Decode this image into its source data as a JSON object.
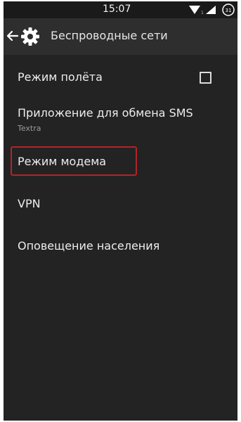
{
  "status_bar": {
    "time": "15:07",
    "icons": [
      "wifi-icon",
      "signal-icon",
      "battery-icon"
    ],
    "battery_level": "31"
  },
  "action_bar": {
    "title": "Беспроводные сети",
    "icons": [
      "back-arrow-icon",
      "gear-icon"
    ]
  },
  "settings": [
    {
      "label": "Режим полёта",
      "has_checkbox": true,
      "checked": false
    },
    {
      "label": "Приложение для обмена SMS",
      "summary": "Textra"
    },
    {
      "label": "Режим модема",
      "highlighted": true
    },
    {
      "label": "VPN"
    },
    {
      "label": "Оповещение населения"
    }
  ],
  "colors": {
    "background": "#232323",
    "action_bar": "#2e2e2e",
    "status_bar": "#1a1a1a",
    "text": "#ededed",
    "summary_text": "#9a9a9a",
    "highlight_border": "#b3232a"
  }
}
